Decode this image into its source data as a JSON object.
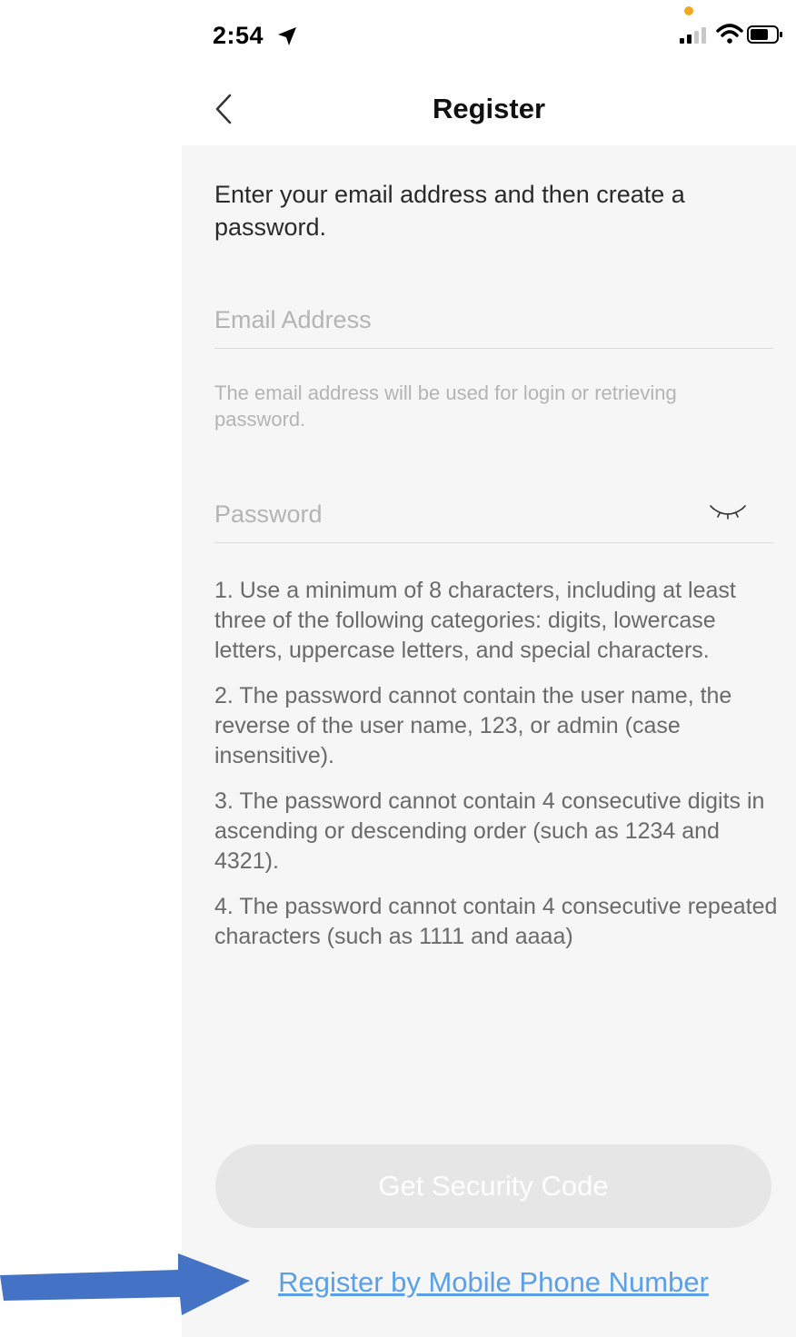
{
  "status_bar": {
    "time": "2:54",
    "icons": [
      "location-arrow-icon",
      "signal-icon",
      "wifi-icon",
      "battery-icon"
    ],
    "indicator_color": "#f5a623"
  },
  "nav": {
    "back_icon": "chevron-left-icon",
    "title": "Register"
  },
  "form": {
    "intro": "Enter your email address and then create a password.",
    "email_placeholder": "Email Address",
    "email_value": "",
    "email_hint": "The email address will be used for login or retrieving password.",
    "password_placeholder": "Password",
    "password_value": "",
    "password_toggle_icon": "eye-closed-icon",
    "rules": [
      "1. Use a minimum of 8 characters, including at least three of the following categories: digits, lowercase letters, uppercase letters, and special characters.",
      "2. The password cannot contain the user name, the reverse of the user name, 123, or admin (case insensitive).",
      "3. The password cannot contain 4 consecutive digits in ascending or descending order (such as 1234 and 4321).",
      "4. The password cannot contain 4 consecutive repeated characters (such as 1111 and aaaa)"
    ]
  },
  "actions": {
    "get_code_label": "Get Security Code",
    "mobile_link_label": "Register by Mobile Phone Number"
  },
  "colors": {
    "link": "#5aa0e8",
    "button_disabled": "#e6e6e6",
    "annotation_arrow": "#4472c4"
  }
}
